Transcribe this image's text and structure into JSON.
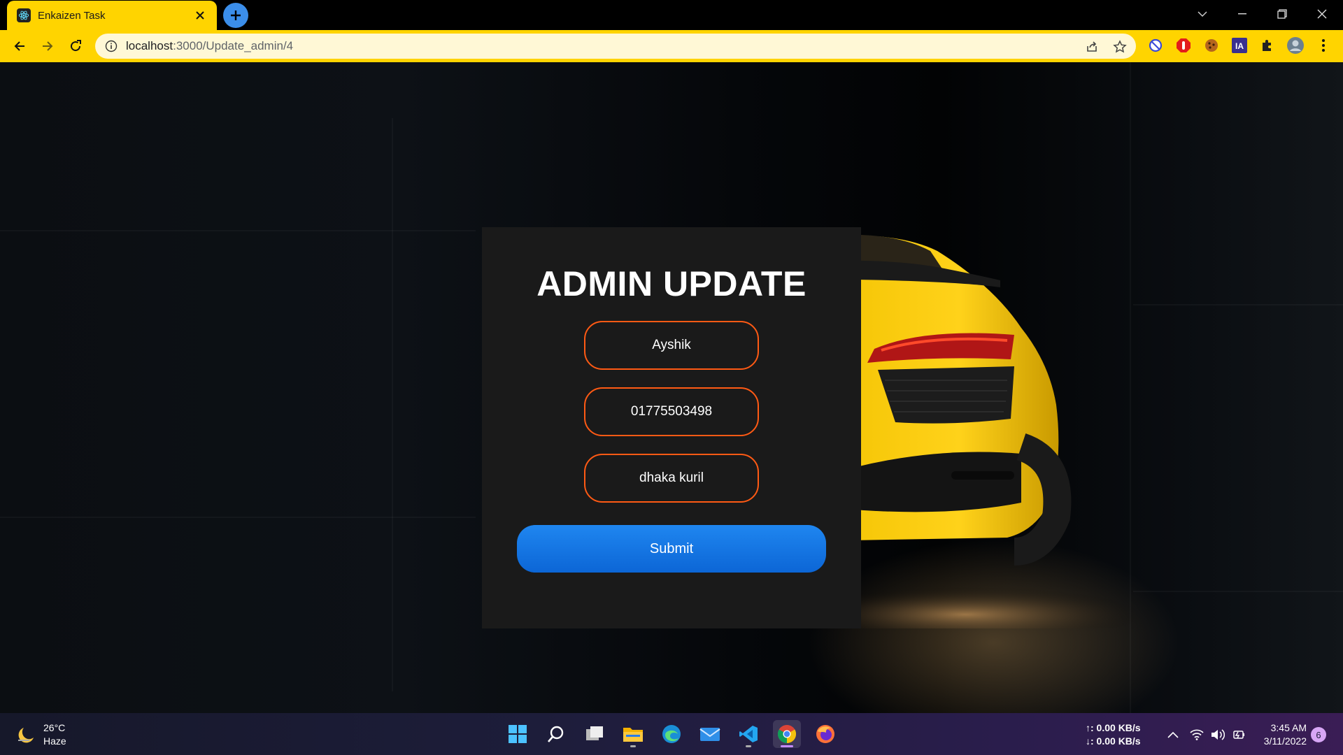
{
  "browser": {
    "tab_title": "Enkaizen Task",
    "url_host": "localhost",
    "url_path": ":3000/Update_admin/4"
  },
  "form": {
    "title": "ADMIN UPDATE",
    "name_value": "Ayshik",
    "phone_value": "01775503498",
    "address_value": "dhaka kuril",
    "submit_label": "Submit"
  },
  "taskbar": {
    "weather_temp": "26°C",
    "weather_desc": "Haze",
    "net_up": "↑: 0.00 KB/s",
    "net_down": "↓: 0.00 KB/s",
    "time": "3:45 AM",
    "date": "3/11/2022",
    "notification_count": "6"
  },
  "colors": {
    "accent": "#ffd400",
    "field_border": "#ff5a14",
    "submit": "#1677e6",
    "card": "#1a1a1a"
  }
}
